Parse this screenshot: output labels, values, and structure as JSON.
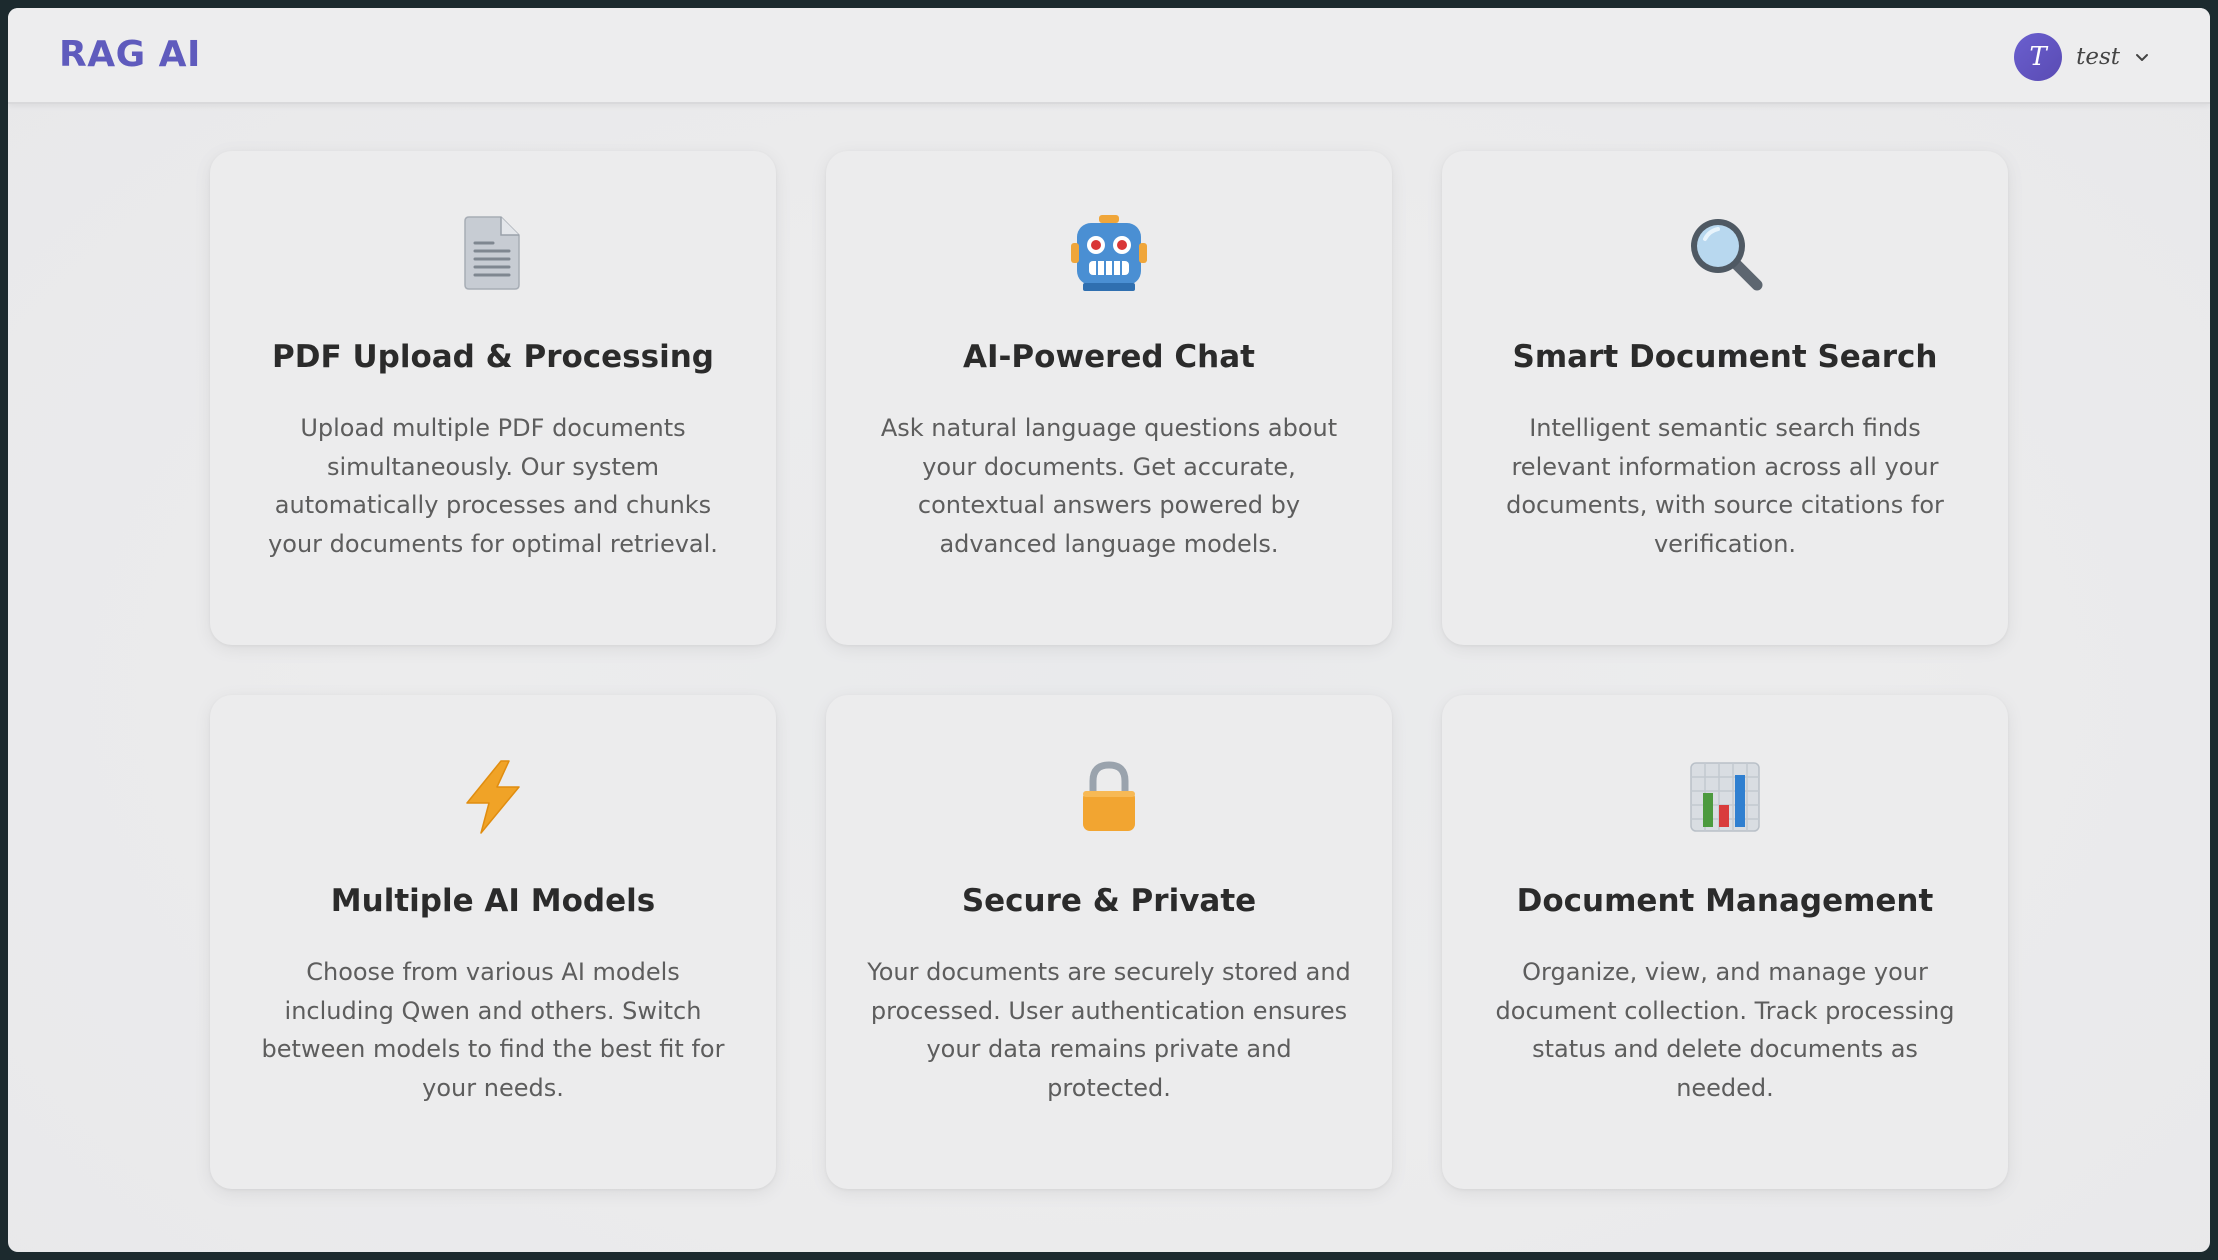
{
  "header": {
    "brand": "RAG AI",
    "user": {
      "initial": "T",
      "name": "test"
    }
  },
  "features": [
    {
      "icon": "document-icon",
      "title": "PDF Upload & Processing",
      "description": "Upload multiple PDF documents simultaneously. Our system automatically processes and chunks your documents for optimal retrieval."
    },
    {
      "icon": "robot-icon",
      "title": "AI-Powered Chat",
      "description": "Ask natural language questions about your documents. Get accurate, contextual answers powered by advanced language models."
    },
    {
      "icon": "magnifier-icon",
      "title": "Smart Document Search",
      "description": "Intelligent semantic search finds relevant information across all your documents, with source citations for verification."
    },
    {
      "icon": "lightning-icon",
      "title": "Multiple AI Models",
      "description": "Choose from various AI models including Qwen and others. Switch between models to find the best fit for your needs."
    },
    {
      "icon": "lock-icon",
      "title": "Secure & Private",
      "description": "Your documents are securely stored and processed. User authentication ensures your data remains private and protected."
    },
    {
      "icon": "bar-chart-icon",
      "title": "Document Management",
      "description": "Organize, view, and manage your document collection. Track processing status and delete documents as needed."
    }
  ],
  "colors": {
    "brand": "#5f5bbd",
    "avatar": "#5a4bb3",
    "title": "#2b2b2b",
    "text": "#5d5d5d"
  }
}
